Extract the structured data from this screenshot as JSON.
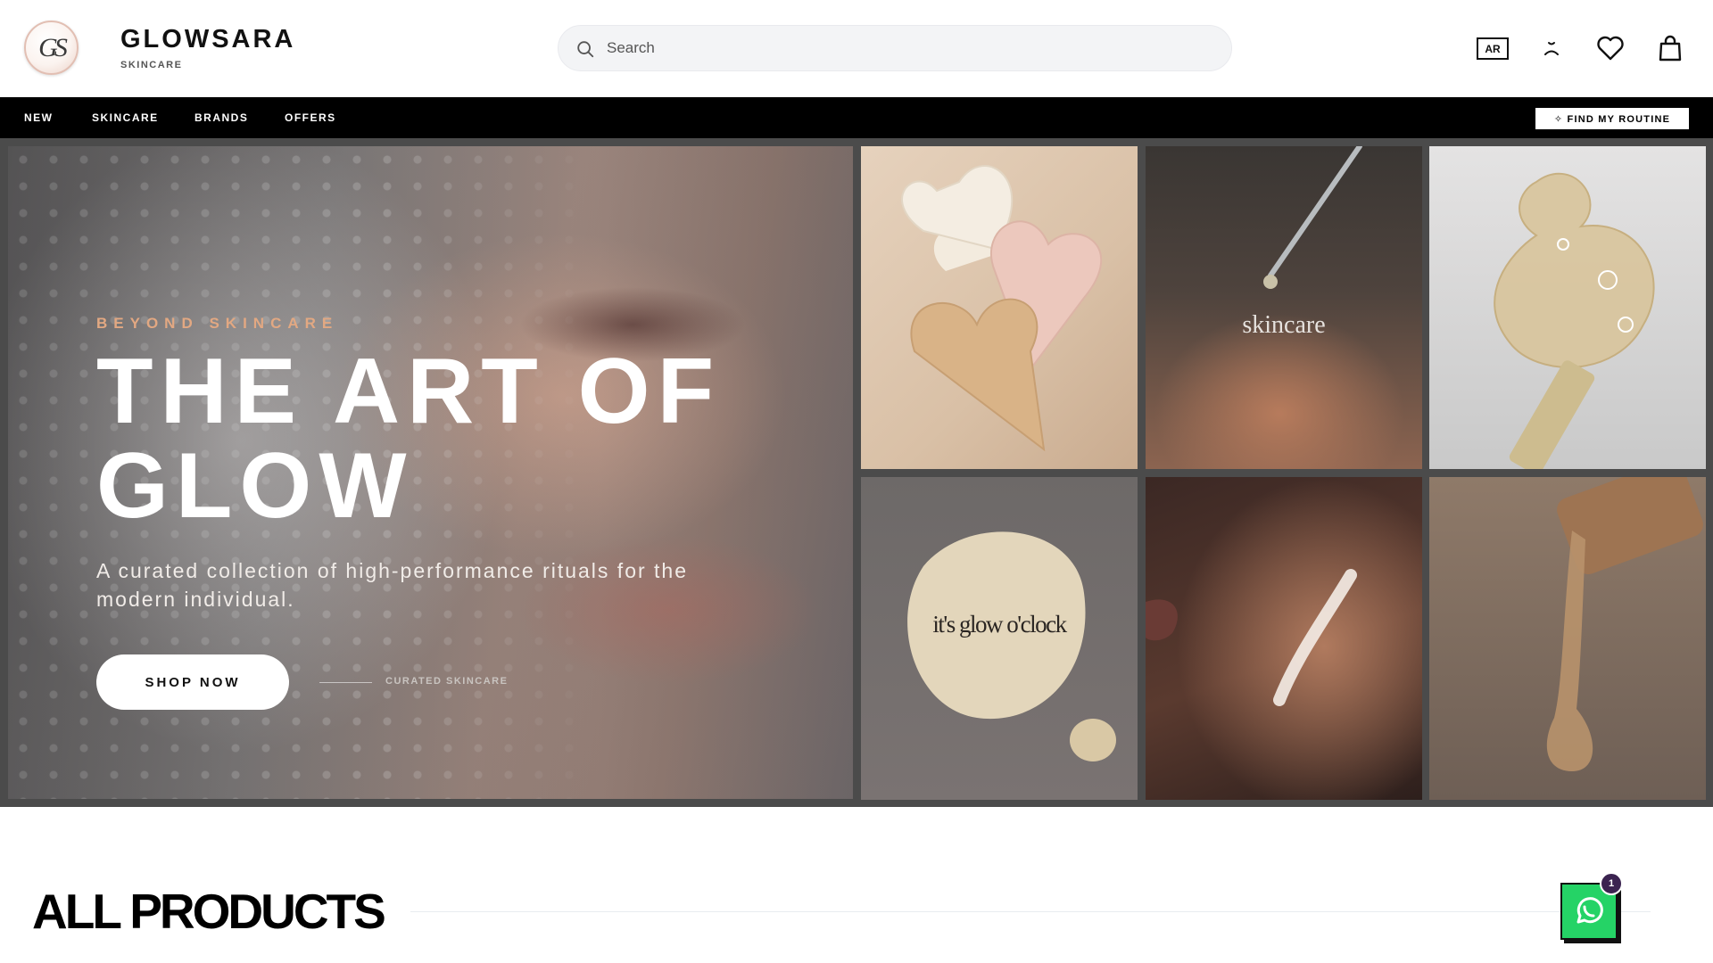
{
  "header": {
    "logo_monogram": "GS",
    "brand_name": "GLOWSARA",
    "brand_sub": "SKINCARE",
    "search_placeholder": "Search",
    "language_label": "AR",
    "icons": [
      "search-icon",
      "user-icon",
      "heart-icon",
      "bag-icon"
    ]
  },
  "nav": {
    "items": [
      {
        "label": "NEW"
      },
      {
        "label": "SKINCARE"
      },
      {
        "label": "BRANDS"
      },
      {
        "label": "OFFERS"
      }
    ],
    "routine_button": "✧ FIND MY ROUTINE"
  },
  "hero": {
    "eyebrow": "BEYOND SKINCARE",
    "title": "THE ART OF GLOW",
    "description": "A curated collection of high-performance rituals for the modern individual.",
    "cta": "SHOP NOW",
    "side_label": "CURATED SKINCARE",
    "tiles": [
      {
        "name": "heart-cream-swatches-image",
        "label": ""
      },
      {
        "name": "dropper-hand-image",
        "label": "skincare"
      },
      {
        "name": "serum-drop-image",
        "label": ""
      },
      {
        "name": "cream-swatch-image",
        "label": "it's glow o'clock"
      },
      {
        "name": "face-cream-image",
        "label": ""
      },
      {
        "name": "oil-pour-image",
        "label": ""
      }
    ]
  },
  "products": {
    "title": "ALL PRODUCTS"
  },
  "whatsapp": {
    "badge_count": "1"
  },
  "colors": {
    "nav_background": "#000000",
    "accent_peach": "#e2a882",
    "whatsapp_green": "#25d366",
    "badge_purple": "#3b2350"
  }
}
